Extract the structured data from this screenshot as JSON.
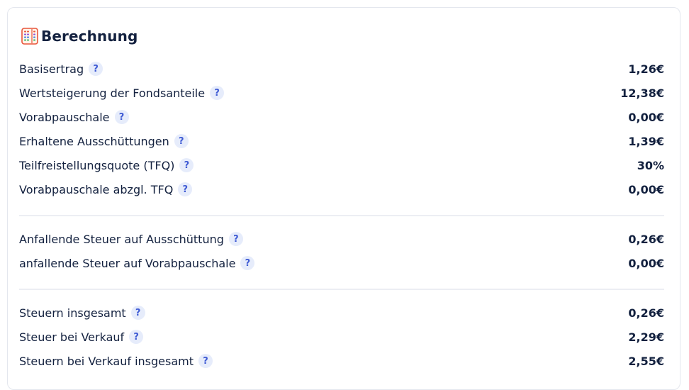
{
  "section": {
    "title": "Berechnung",
    "icon": "abacus-icon"
  },
  "colors": {
    "text": "#13213f",
    "help_bg": "#e6ecfb",
    "help_fg": "#3f5bd4",
    "divider": "#eceef3"
  },
  "help_symbol": "?",
  "rows": [
    {
      "label": "Basisertrag",
      "value": "1,26€"
    },
    {
      "label": "Wertsteigerung der Fondsanteile",
      "value": "12,38€"
    },
    {
      "label": "Vorabpauschale",
      "value": "0,00€"
    },
    {
      "label": "Erhaltene Ausschüttungen",
      "value": "1,39€"
    },
    {
      "label": "Teilfreistellungsquote (TFQ)",
      "value": "30%"
    },
    {
      "label": "Vorabpauschale abzgl. TFQ",
      "value": "0,00€"
    },
    {
      "label": "Anfallende Steuer auf Ausschüttung",
      "value": "0,26€"
    },
    {
      "label": "anfallende Steuer auf Vorabpauschale",
      "value": "0,00€"
    },
    {
      "label": "Steuern insgesamt",
      "value": "0,26€"
    },
    {
      "label": "Steuer bei Verkauf",
      "value": "2,29€"
    },
    {
      "label": "Steuern bei Verkauf insgesamt",
      "value": "2,55€"
    }
  ]
}
